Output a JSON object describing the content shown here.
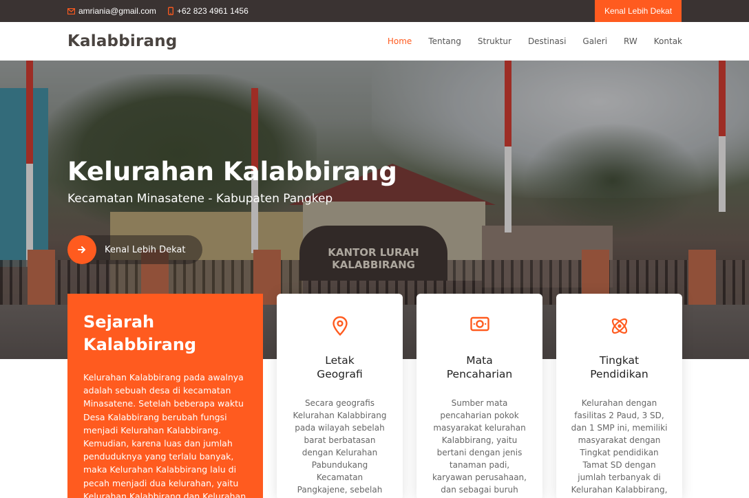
{
  "topbar": {
    "email": "amriania@gmail.com",
    "phone": "+62 823 4961 1456",
    "cta_label": "Kenal Lebih Dekat"
  },
  "header": {
    "brand": "Kalabbirang",
    "nav": [
      "Home",
      "Tentang",
      "Struktur",
      "Destinasi",
      "Galeri",
      "RW",
      "Kontak"
    ],
    "active_nav": "Home"
  },
  "hero": {
    "title": "Kelurahan Kalabbirang",
    "subtitle": "Kecamatan Minasatene - Kabupaten Pangkep",
    "button_label": "Kenal Lebih Dekat",
    "sign_lines": [
      "KANTOR LURAH",
      "KALABBIRANG"
    ]
  },
  "history": {
    "title": "Sejarah Kalabbirang",
    "text": "Kelurahan Kalabbirang pada awalnya adalah sebuah desa di kecamatan Minasatene. Setelah beberapa waktu Desa Kalabbirang berubah fungsi menjadi Kelurahan Kalabbirang. Kemudian, karena luas dan jumlah penduduknya yang terlalu banyak, maka Kelurahan Kalabbirang lalu di pecah menjadi dua kelurahan, yaitu Kelurahan Kalabbirang dan Kelurahan"
  },
  "features": [
    {
      "icon": "map-pin-icon",
      "title_line1": "Letak",
      "title_line2": "Geografi",
      "text": "Secara geografis Kelurahan Kalabbirang pada wilayah sebelah barat berbatasan dengan Kelurahan Pabundukang Kecamatan Pangkajene, sebelah timur dan utara"
    },
    {
      "icon": "money-icon",
      "title_line1": "Mata",
      "title_line2": "Pencaharian",
      "text": "Sumber mata pencaharian pokok masyarakat kelurahan Kalabbirang, yaitu bertani dengan jenis tanaman padi, karyawan perusahaan, dan sebagai buruh"
    },
    {
      "icon": "atom-icon",
      "title_line1": "Tingkat",
      "title_line2": "Pendidikan",
      "text": "Kelurahan dengan fasilitas 2 Paud, 3 SD, dan 1 SMP ini, memiliki masyarakat dengan Tingkat pendidikan Tamat SD dengan jumlah terbanyak di Kelurahan Kalabbirang,"
    }
  ],
  "colors": {
    "accent": "#ff5b1f",
    "topbar_bg": "#3a3332"
  }
}
